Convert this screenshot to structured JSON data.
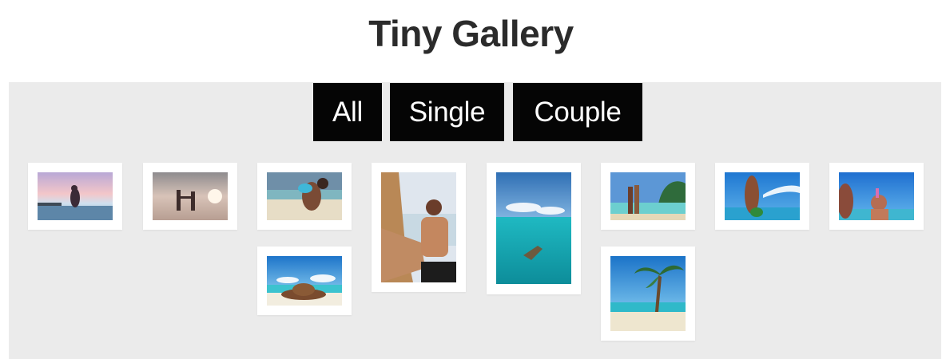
{
  "app": {
    "title": "Tiny Gallery"
  },
  "filters": [
    {
      "label": "All",
      "active": true
    },
    {
      "label": "Single",
      "active": false
    },
    {
      "label": "Couple",
      "active": false
    }
  ],
  "colors": {
    "panel_background": "#ebebeb",
    "button_background": "#050505",
    "button_text": "#ffffff",
    "title_text": "#2b2b2b",
    "thumbnail_frame": "#ffffff"
  },
  "gallery": {
    "photos": [
      {
        "subject": "couple-silhouette-sunset",
        "category": "Couple"
      },
      {
        "subject": "couple-dancing-beach-sunset",
        "category": "Couple"
      },
      {
        "subject": "couple-embrace-beach",
        "category": "Couple"
      },
      {
        "subject": "couple-portrait-beach",
        "category": "Couple"
      },
      {
        "subject": "swimmer-turquoise-sea",
        "category": "Single"
      },
      {
        "subject": "couple-in-shallow-water",
        "category": "Couple"
      },
      {
        "subject": "woman-bikini-beach",
        "category": "Single"
      },
      {
        "subject": "couple-toast-beach",
        "category": "Couple"
      },
      {
        "subject": "hat-on-sand-beach",
        "category": "Single"
      },
      {
        "subject": "palm-tree-beach",
        "category": "Single"
      }
    ]
  }
}
